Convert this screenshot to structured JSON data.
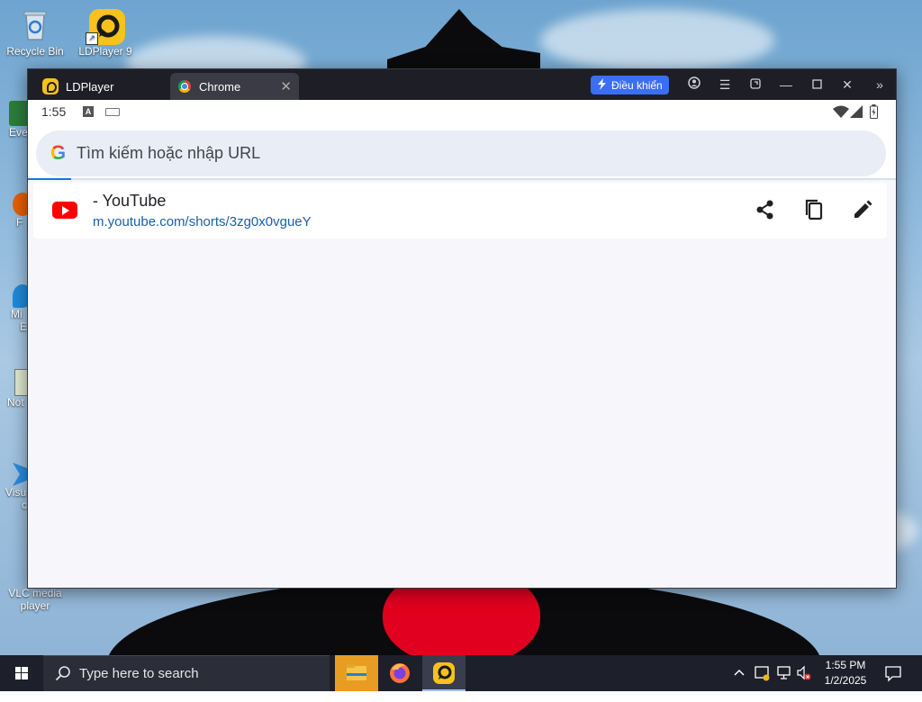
{
  "desktop": {
    "icons": [
      {
        "label": "Recycle Bin",
        "icon": "recycle-bin-icon"
      },
      {
        "label": "LDPlayer 9",
        "icon": "ldplayer-icon"
      }
    ],
    "edge_labels": [
      "Eve",
      "F",
      "Mi",
      "E",
      "Not",
      "Visu",
      "c"
    ],
    "vlc_label_1": "VLC media",
    "vlc_label_2": "player"
  },
  "window": {
    "tabs": [
      {
        "label": "LDPlayer",
        "icon": "ldplayer-icon"
      },
      {
        "label": "Chrome",
        "icon": "chrome-icon",
        "active": true
      }
    ],
    "control_button": "Điều khiển",
    "toolbar_icons": [
      "account-icon",
      "menu-icon",
      "restore-icon",
      "minimize-icon",
      "maximize-icon",
      "close-icon",
      "expand-icon"
    ]
  },
  "android": {
    "time": "1:55",
    "status_icons": [
      "a-icon",
      "keyboard-icon",
      "wifi-icon",
      "signal-icon",
      "battery-icon"
    ]
  },
  "browser": {
    "search_placeholder": "Tìm kiếm hoặc nhập URL",
    "suggestion": {
      "title": "- YouTube",
      "url": "m.youtube.com/shorts/3zg0x0vgueY",
      "actions": [
        "share-icon",
        "copy-icon",
        "edit-icon"
      ]
    }
  },
  "taskbar": {
    "search_placeholder": "Type here to search",
    "apps": [
      "file-explorer-icon",
      "firefox-icon",
      "ldplayer-icon"
    ],
    "time": "1:55 PM",
    "date": "1/2/2025"
  },
  "colors": {
    "accent": "#3b6ef5",
    "titlebar": "#1e1f26",
    "youtube_red": "#ff0000",
    "link": "#1a5fa8"
  }
}
